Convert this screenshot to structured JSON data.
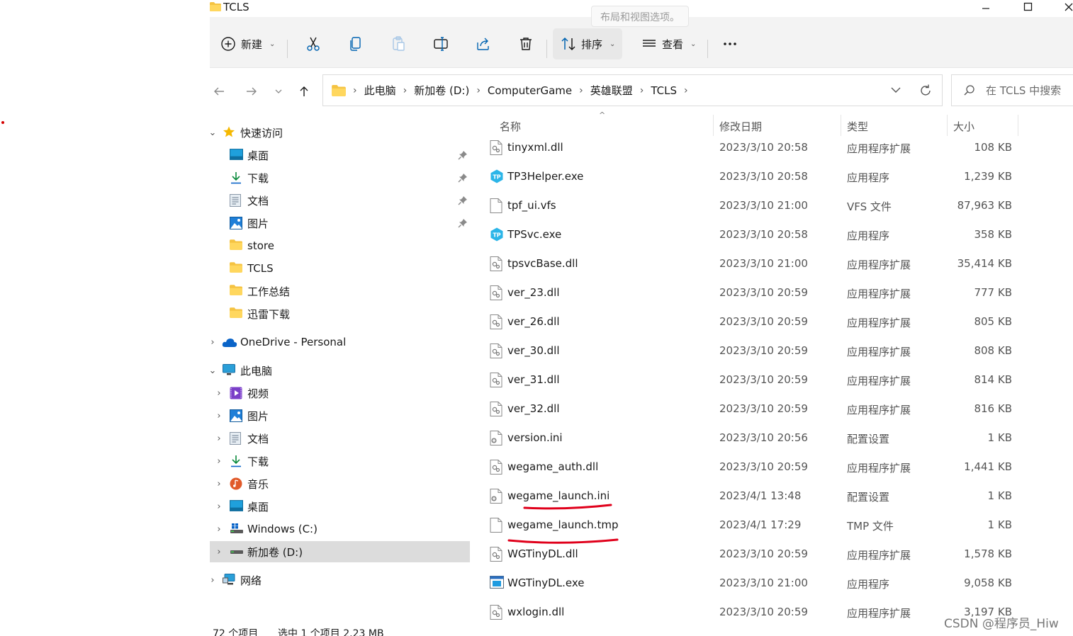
{
  "window": {
    "title": "TCLS",
    "tooltip": "布局和视图选项。"
  },
  "toolbar": {
    "new_label": "新建",
    "sort_label": "排序",
    "view_label": "查看"
  },
  "address": {
    "crumbs": [
      "此电脑",
      "新加卷 (D:)",
      "ComputerGame",
      "英雄联盟",
      "TCLS"
    ]
  },
  "search": {
    "placeholder": "在 TCLS 中搜索"
  },
  "sidebar": {
    "quick_access": "快速访问",
    "quick_items": [
      {
        "label": "桌面",
        "icon": "desktop-icon",
        "pinned": true
      },
      {
        "label": "下载",
        "icon": "download-icon",
        "pinned": true
      },
      {
        "label": "文档",
        "icon": "document-icon",
        "pinned": true
      },
      {
        "label": "图片",
        "icon": "picture-icon",
        "pinned": true
      },
      {
        "label": "store",
        "icon": "folder-icon",
        "pinned": false
      },
      {
        "label": "TCLS",
        "icon": "folder-icon",
        "pinned": false
      },
      {
        "label": "工作总结",
        "icon": "folder-icon",
        "pinned": false
      },
      {
        "label": "迅雷下载",
        "icon": "folder-icon",
        "pinned": false
      }
    ],
    "onedrive": "OneDrive - Personal",
    "this_pc": "此电脑",
    "pc_items": [
      {
        "label": "视频",
        "icon": "video-icon"
      },
      {
        "label": "图片",
        "icon": "picture-icon"
      },
      {
        "label": "文档",
        "icon": "document-icon"
      },
      {
        "label": "下载",
        "icon": "download-icon"
      },
      {
        "label": "音乐",
        "icon": "music-icon"
      },
      {
        "label": "桌面",
        "icon": "desktop-icon"
      },
      {
        "label": "Windows (C:)",
        "icon": "windows-drive-icon"
      },
      {
        "label": "新加卷 (D:)",
        "icon": "drive-icon",
        "selected": true
      }
    ],
    "network": "网络"
  },
  "columns": {
    "name": "名称",
    "date": "修改日期",
    "type": "类型",
    "size": "大小"
  },
  "files": [
    {
      "name": "tinyxml.dll",
      "date": "2023/3/10 20:58",
      "type": "应用程序扩展",
      "size": "108 KB",
      "icon": "dll"
    },
    {
      "name": "TP3Helper.exe",
      "date": "2023/3/10 20:58",
      "type": "应用程序",
      "size": "1,239 KB",
      "icon": "tp"
    },
    {
      "name": "tpf_ui.vfs",
      "date": "2023/3/10 21:00",
      "type": "VFS 文件",
      "size": "87,963 KB",
      "icon": "blank"
    },
    {
      "name": "TPSvc.exe",
      "date": "2023/3/10 20:58",
      "type": "应用程序",
      "size": "358 KB",
      "icon": "tp"
    },
    {
      "name": "tpsvcBase.dll",
      "date": "2023/3/10 21:00",
      "type": "应用程序扩展",
      "size": "35,414 KB",
      "icon": "dll"
    },
    {
      "name": "ver_23.dll",
      "date": "2023/3/10 20:59",
      "type": "应用程序扩展",
      "size": "777 KB",
      "icon": "dll"
    },
    {
      "name": "ver_26.dll",
      "date": "2023/3/10 20:59",
      "type": "应用程序扩展",
      "size": "805 KB",
      "icon": "dll"
    },
    {
      "name": "ver_30.dll",
      "date": "2023/3/10 20:59",
      "type": "应用程序扩展",
      "size": "808 KB",
      "icon": "dll"
    },
    {
      "name": "ver_31.dll",
      "date": "2023/3/10 20:59",
      "type": "应用程序扩展",
      "size": "814 KB",
      "icon": "dll"
    },
    {
      "name": "ver_32.dll",
      "date": "2023/3/10 20:59",
      "type": "应用程序扩展",
      "size": "816 KB",
      "icon": "dll"
    },
    {
      "name": "version.ini",
      "date": "2023/3/10 20:56",
      "type": "配置设置",
      "size": "1 KB",
      "icon": "ini"
    },
    {
      "name": "wegame_auth.dll",
      "date": "2023/3/10 20:59",
      "type": "应用程序扩展",
      "size": "1,441 KB",
      "icon": "dll"
    },
    {
      "name": "wegame_launch.ini",
      "date": "2023/4/1 13:48",
      "type": "配置设置",
      "size": "1 KB",
      "icon": "ini"
    },
    {
      "name": "wegame_launch.tmp",
      "date": "2023/4/1 17:29",
      "type": "TMP 文件",
      "size": "1 KB",
      "icon": "blank"
    },
    {
      "name": "WGTinyDL.dll",
      "date": "2023/3/10 20:59",
      "type": "应用程序扩展",
      "size": "1,578 KB",
      "icon": "dll"
    },
    {
      "name": "WGTinyDL.exe",
      "date": "2023/3/10 21:00",
      "type": "应用程序",
      "size": "9,058 KB",
      "icon": "exe"
    },
    {
      "name": "wxlogin.dll",
      "date": "2023/3/10 20:59",
      "type": "应用程序扩展",
      "size": "3,197 KB",
      "icon": "dll"
    }
  ],
  "status": {
    "count": "72 个项目",
    "selection": "选中 1 个项目 2.23 MB"
  },
  "watermark": "CSDN @程序员_Hiw",
  "colors": {
    "folder": "#f5c342",
    "accent": "#0063b1",
    "annotation": "#e0001b",
    "selected_bg": "#dcdcdc"
  }
}
